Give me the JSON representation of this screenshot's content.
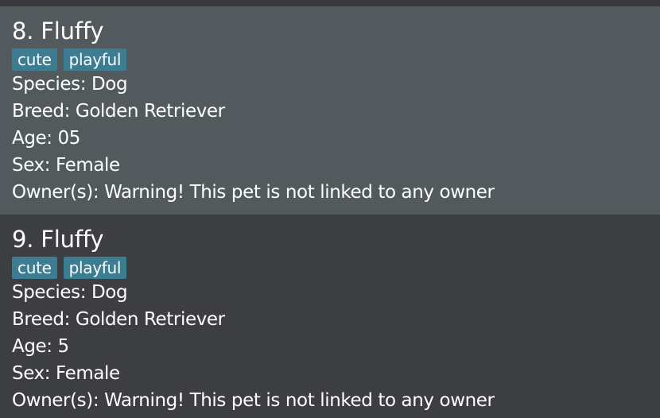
{
  "pets": [
    {
      "name": "8. Fluffy",
      "tags": [
        "cute",
        "playful"
      ],
      "species": "Species: Dog",
      "breed": "Breed: Golden Retriever",
      "age": "Age: 05",
      "sex": "Sex: Female",
      "owners": "Owner(s): Warning! This pet is not linked to any owner"
    },
    {
      "name": "9. Fluffy",
      "tags": [
        "cute",
        "playful"
      ],
      "species": "Species: Dog",
      "breed": "Breed: Golden Retriever",
      "age": "Age: 5",
      "sex": "Sex: Female",
      "owners": "Owner(s): Warning! This pet is not linked to any owner"
    }
  ],
  "colors": {
    "background": "#3c3e42",
    "selected_card": "#535a5e",
    "tag": "#3d7d92",
    "text": "#ffffff"
  }
}
